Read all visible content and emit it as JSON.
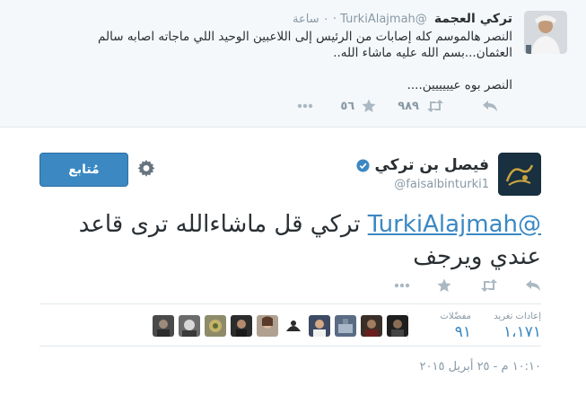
{
  "reply_tweet": {
    "name": "تركي العجمة",
    "handle": "@TurkiAlajmah",
    "time": "٠ ساعة",
    "text_line1": "النصر هالموسم كله إصابات من الرئيس إلى اللاعبين الوحيد اللي ماجاته اصابه سالم العثمان...بسم الله عليه ماشاء الله..",
    "text_line2": "النصر بوه عيييييين....",
    "retweet_count": "٩٨٩",
    "favorite_count": "٥٦",
    "icons": [
      "reply-icon",
      "retweet-icon",
      "favorite-star-icon",
      "more-dots-icon"
    ]
  },
  "main_tweet": {
    "name": "فيصل بن تركي",
    "handle": "@faisalbinturki1",
    "follow_label": "مُتابع",
    "mention": "@TurkiAlajmah",
    "text": "تركي قل ماشاءالله ترى قاعد عندي ويرجف",
    "retweets_label": "إعادات تغريد",
    "retweets_count": "١،١٧١",
    "favorites_label": "مفضّلات",
    "favorites_count": "٩١",
    "timestamp": "١٠:١٠ م - ٢٥ أبريل ٢٠١٥",
    "icons": [
      "verified-badge-icon",
      "settings-gear-icon",
      "reply-icon",
      "retweet-icon",
      "favorite-star-icon",
      "more-dots-icon"
    ]
  },
  "colors": {
    "accent_blue": "#3b88c3",
    "muted_gray": "#8899a6",
    "text_dark": "#292f33",
    "reply_bg": "#f5f8fa"
  }
}
